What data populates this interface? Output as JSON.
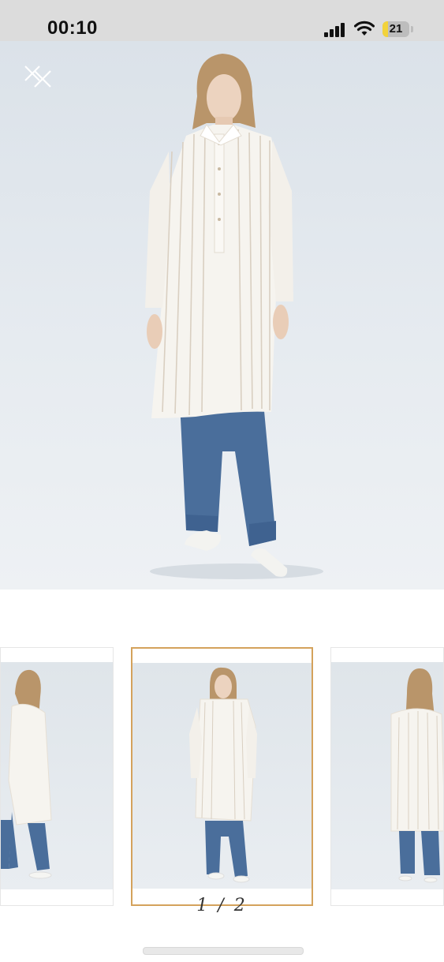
{
  "status_bar": {
    "time": "00:10",
    "battery_percent": "21",
    "battery_level": 0.21,
    "icons": [
      "cellular-signal-icon",
      "wifi-icon",
      "battery-icon"
    ]
  },
  "gallery": {
    "close_icon": "close-icon",
    "current_page": "1",
    "total_pages": "2",
    "pager_text": "1 / 2",
    "accent_color": "#d4a25c"
  }
}
